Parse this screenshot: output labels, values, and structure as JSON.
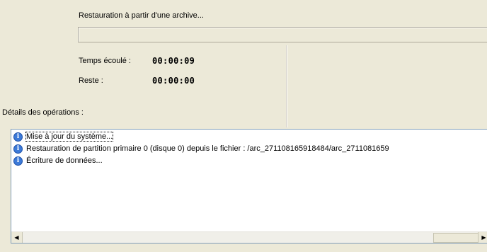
{
  "operation": {
    "title": "Restauration à partir d'une archive...",
    "elapsed_label": "Temps écoulé :",
    "elapsed_value": "00:00:09",
    "remaining_label": "Reste :",
    "remaining_value": "00:00:00",
    "progress_fraction": 0
  },
  "details": {
    "label": "Détails des opérations :",
    "items": [
      {
        "icon": "info-icon",
        "text": "Mise à jour du système..."
      },
      {
        "icon": "info-icon",
        "text": "Restauration de partition primaire 0 (disque 0) depuis le fichier : /arc_271108165918484/arc_2711081659"
      },
      {
        "icon": "info-icon",
        "text": "Écriture de données..."
      }
    ]
  },
  "scrollbar": {
    "left_arrow": "◀",
    "right_arrow": "▶"
  },
  "colors": {
    "window_bg": "#ece9d8",
    "list_bg": "#ffffff",
    "list_border": "#7f9db9",
    "info_icon": "#3d7ad8"
  }
}
